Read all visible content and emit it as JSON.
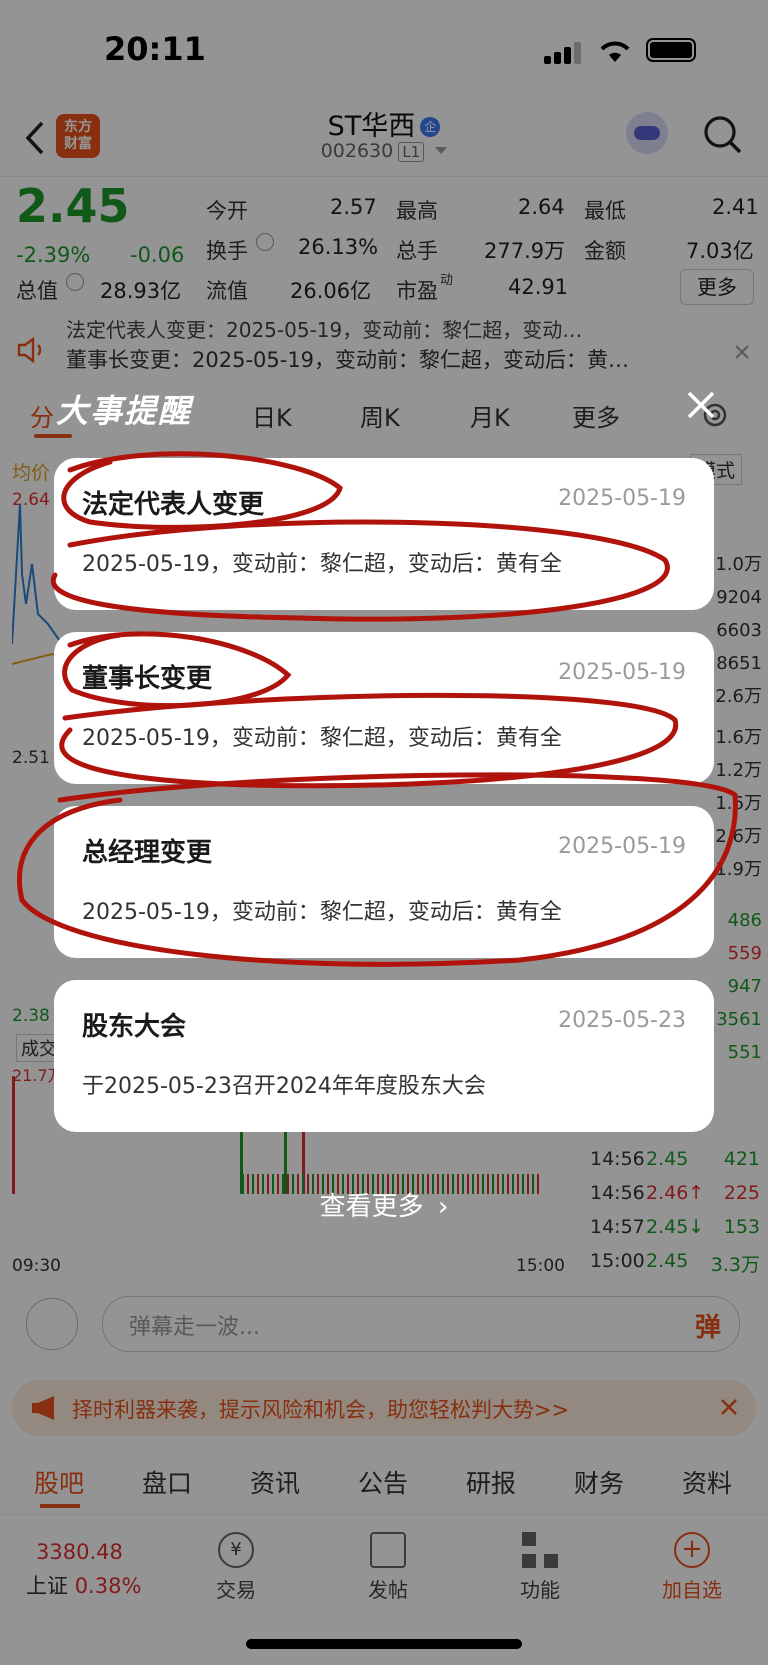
{
  "status": {
    "time": "20:11"
  },
  "header": {
    "logo": [
      "东方",
      "财富"
    ],
    "stock_name": "ST华西",
    "enterprise_badge": "企",
    "code": "002630",
    "level": "L1"
  },
  "quote": {
    "price": "2.45",
    "change_pct": "-2.39%",
    "change": "-0.06",
    "open_label": "今开",
    "open": "2.57",
    "high_label": "最高",
    "high": "2.64",
    "low_label": "最低",
    "low": "2.41",
    "turnover_label": "换手",
    "turnover": "26.13%",
    "volume_label": "总手",
    "volume": "277.9万",
    "amount_label": "金额",
    "amount": "7.03亿",
    "mktcap_label": "总值",
    "mktcap": "28.93亿",
    "float_label": "流值",
    "float": "26.06亿",
    "pe_label": "市盈",
    "pe_super": "动",
    "pe": "42.91",
    "more_button": "更多"
  },
  "notice": {
    "line1": "法定代表人变更：2025-05-19，变动前：黎仁超，变动…",
    "line2": "董事长变更：2025-05-19，变动前：黎仁超，变动后：黄…"
  },
  "chart_tabs": [
    "分",
    "日K",
    "周K",
    "月K",
    "更多"
  ],
  "chart": {
    "avg_label": "均价",
    "mode_label": "模式",
    "y_high": "2.64",
    "y_mid": "2.51",
    "y_low": "2.38",
    "vol_label": "成交",
    "vol_max": "21.7万",
    "time_start": "09:30",
    "time_end": "15:00",
    "right_col_partial": [
      "1.0万",
      "9204",
      "6603",
      "8651",
      "2.6万",
      "1.6万",
      "1.2万",
      "1.6万",
      "2.6万",
      "1.9万",
      "486",
      "559",
      "947",
      "3561",
      "551"
    ],
    "ticks": [
      {
        "time": "14:56",
        "price": "2.45",
        "vol": "421"
      },
      {
        "time": "14:56",
        "price": "2.46↑",
        "vol": "225"
      },
      {
        "time": "14:57",
        "price": "2.45↓",
        "vol": "153"
      },
      {
        "time": "15:00",
        "price": "2.45",
        "vol": "3.3万"
      }
    ]
  },
  "danmu": {
    "placeholder": "弹幕走一波...",
    "button": "弹"
  },
  "banner": {
    "text": "择时利器来袭，提示风险和机会，助您轻松判大势>>"
  },
  "bottom_tabs": [
    "股吧",
    "盘口",
    "资讯",
    "公告",
    "研报",
    "财务",
    "资料"
  ],
  "bottom_nav": {
    "index_value": "3380.48",
    "index_name": "上证",
    "index_change": "0.38%",
    "items": [
      "交易",
      "发帖",
      "功能",
      "加自选"
    ]
  },
  "overlay": {
    "title": "大事提醒",
    "events": [
      {
        "title": "法定代表人变更",
        "date": "2025-05-19",
        "desc": "2025-05-19，变动前：黎仁超，变动后：黄有全"
      },
      {
        "title": "董事长变更",
        "date": "2025-05-19",
        "desc": "2025-05-19，变动前：黎仁超，变动后：黄有全"
      },
      {
        "title": "总经理变更",
        "date": "2025-05-19",
        "desc": "2025-05-19，变动前：黎仁超，变动后：黄有全"
      },
      {
        "title": "股东大会",
        "date": "2025-05-23",
        "desc": "于2025-05-23召开2024年年度股东大会"
      }
    ],
    "view_more": "查看更多"
  },
  "colors": {
    "accent": "#e8511a",
    "up": "#e03131",
    "down": "#1d9a2c",
    "annotation": "#b0130b"
  }
}
